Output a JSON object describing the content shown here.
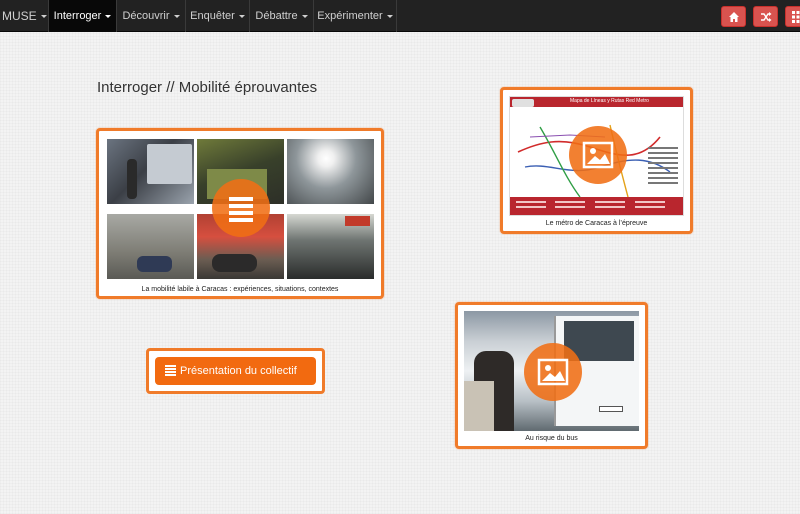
{
  "navbar": {
    "brand": "MUSE",
    "items": [
      {
        "label": "Interroger",
        "active": true
      },
      {
        "label": "Découvrir"
      },
      {
        "label": "Enquêter"
      },
      {
        "label": "Débattre"
      },
      {
        "label": "Expérimenter"
      }
    ],
    "buttons": [
      "home-icon",
      "shuffle-icon",
      "grid-icon"
    ],
    "button_color": "#d9534f"
  },
  "page": {
    "title": "Interroger // Mobilité éprouvantes"
  },
  "cards": {
    "mosaic": {
      "caption": "La mobilité labile à Caracas : expériences, situations, contextes",
      "icon": "list-icon"
    },
    "metro": {
      "caption": "Le métro de Caracas à l’épreuve",
      "map_title": "Mapa de Líneas y Rutas Red Metro",
      "icon": "image-icon"
    },
    "bus": {
      "caption": "Au risque du bus",
      "icon": "image-icon"
    }
  },
  "present_button": {
    "label": "Présentation du collectif",
    "icon": "list-icon"
  },
  "colors": {
    "accent": "#f07b2a",
    "navbar": "#222222"
  }
}
